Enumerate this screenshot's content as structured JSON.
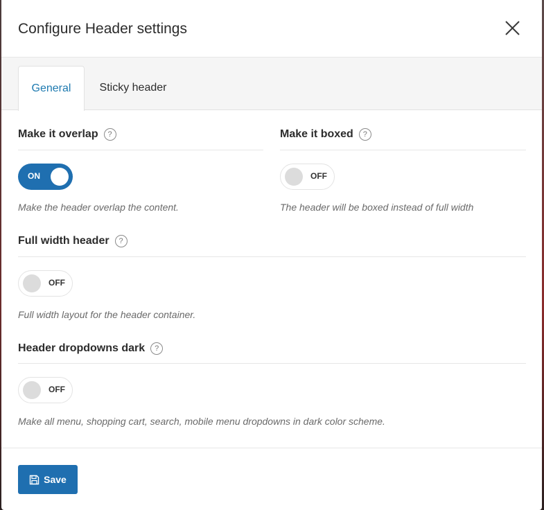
{
  "modal": {
    "title": "Configure Header settings"
  },
  "tabs": [
    {
      "label": "General",
      "active": true
    },
    {
      "label": "Sticky header",
      "active": false
    }
  ],
  "fields": {
    "overlap": {
      "label": "Make it overlap",
      "state": "ON",
      "enabled": true,
      "description": "Make the header overlap the content."
    },
    "boxed": {
      "label": "Make it boxed",
      "state": "OFF",
      "enabled": false,
      "description": "The header will be boxed instead of full width"
    },
    "full_width": {
      "label": "Full width header",
      "state": "OFF",
      "enabled": false,
      "description": "Full width layout for the header container."
    },
    "dropdowns_dark": {
      "label": "Header dropdowns dark",
      "state": "OFF",
      "enabled": false,
      "description": "Make all menu, shopping cart, search, mobile menu dropdowns in dark color scheme."
    }
  },
  "help_glyph": "?",
  "footer": {
    "save_label": "Save"
  },
  "colors": {
    "accent": "#1f6fb0",
    "active_tab_text": "#1e7ab0"
  },
  "icons": {
    "close": "close-icon",
    "help": "question-circle-icon",
    "save": "floppy-disk-icon"
  }
}
